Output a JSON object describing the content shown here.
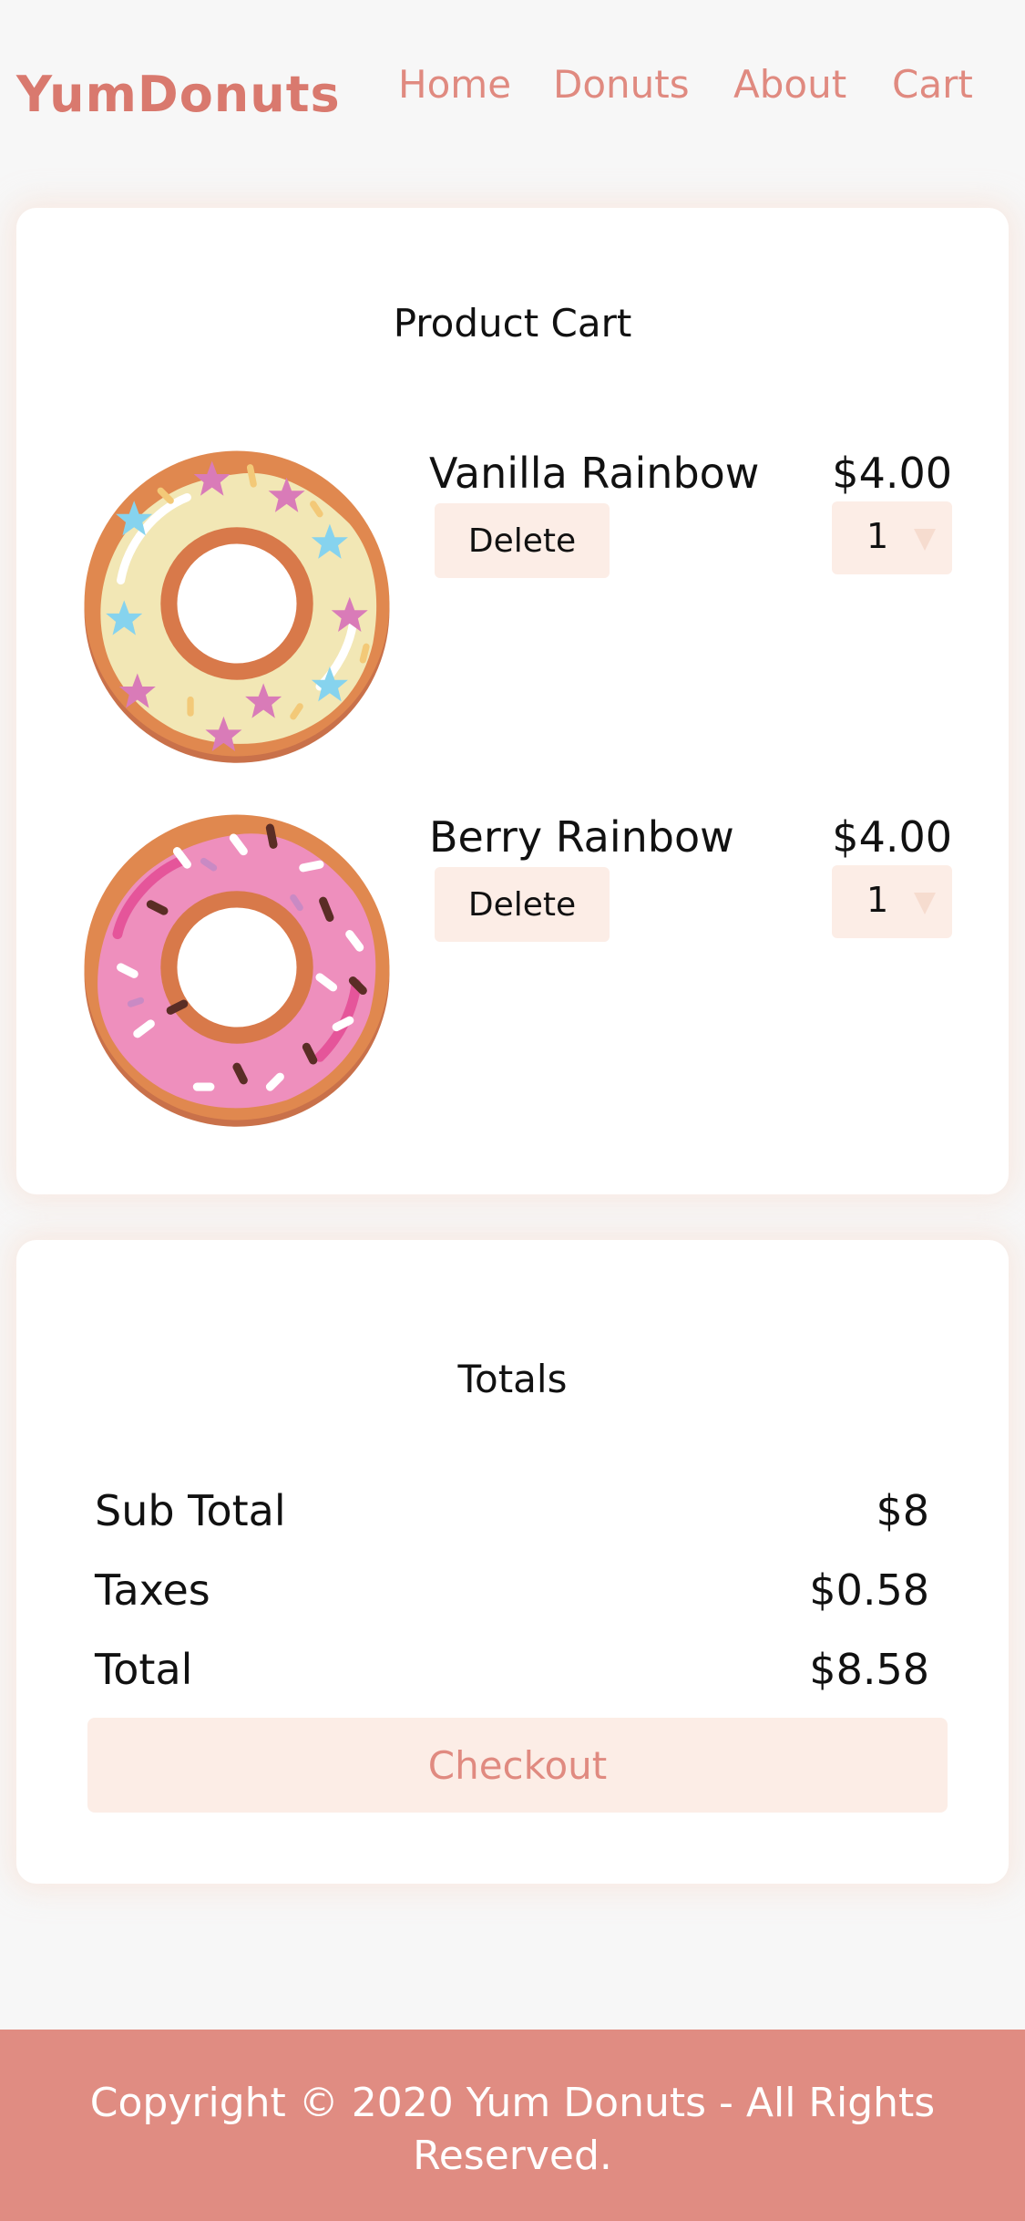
{
  "header": {
    "logo": "YumDonuts",
    "nav": [
      {
        "label": "Home"
      },
      {
        "label": "Donuts"
      },
      {
        "label": "About"
      },
      {
        "label": "Cart"
      }
    ]
  },
  "cart": {
    "title": "Product Cart",
    "items": [
      {
        "name": "Vanilla Rainbow",
        "price": "$4.00",
        "quantity": "1",
        "delete_label": "Delete",
        "icon": "vanilla-donut-icon"
      },
      {
        "name": "Berry Rainbow",
        "price": "$4.00",
        "quantity": "1",
        "delete_label": "Delete",
        "icon": "berry-donut-icon"
      }
    ]
  },
  "totals": {
    "title": "Totals",
    "subtotal_label": "Sub Total",
    "subtotal_value": "$8",
    "taxes_label": "Taxes",
    "taxes_value": "$0.58",
    "total_label": "Total",
    "total_value": "$8.58",
    "checkout_label": "Checkout"
  },
  "footer": {
    "copyright": "Copyright © 2020 Yum Donuts - All Rights Reserved."
  },
  "colors": {
    "brand": "#e08a80",
    "accent_bg": "#fcede6",
    "footer_bg": "#e08c82",
    "page_bg": "#f7f7f7"
  }
}
